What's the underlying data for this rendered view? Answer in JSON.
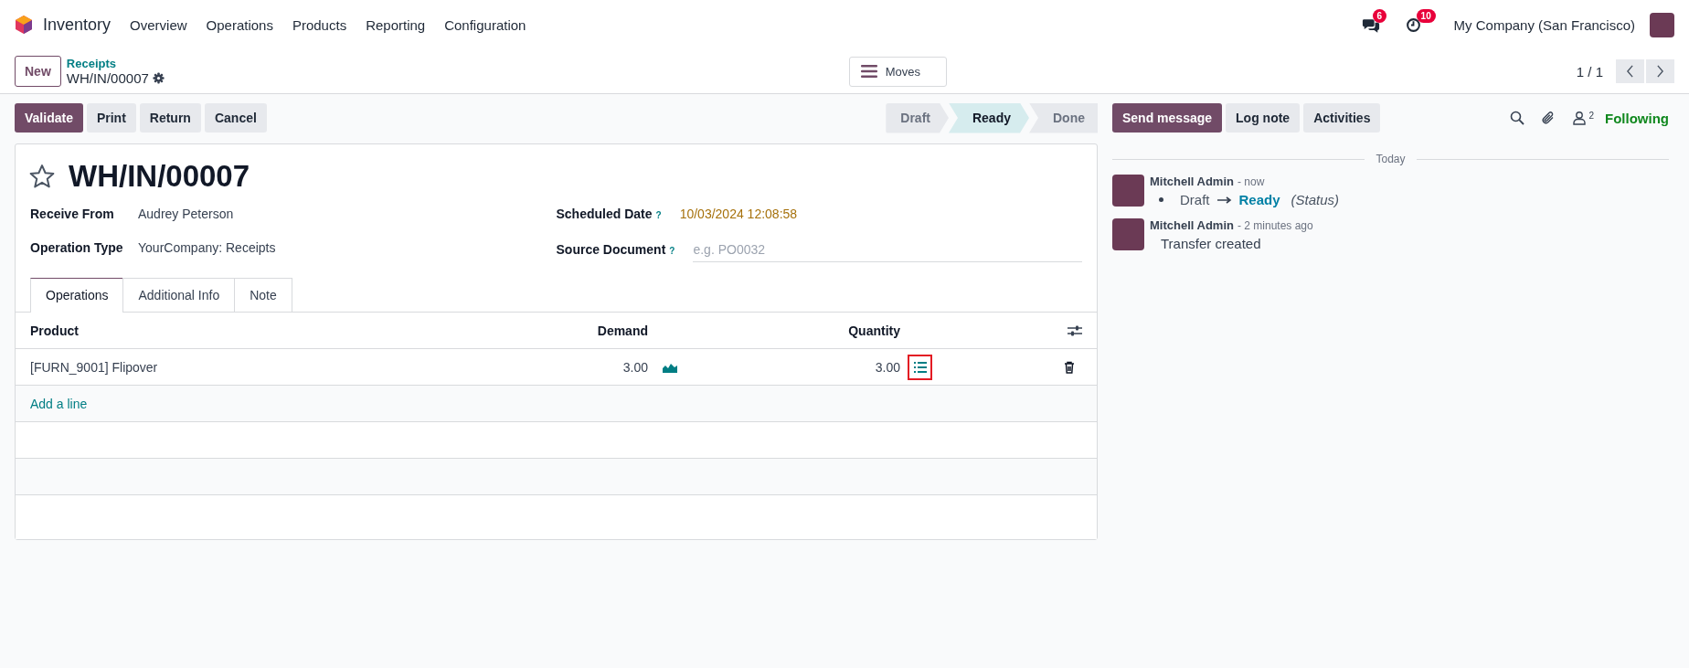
{
  "navbar": {
    "app": "Inventory",
    "menus": [
      "Overview",
      "Operations",
      "Products",
      "Reporting",
      "Configuration"
    ],
    "messages_badge": "6",
    "activities_badge": "10",
    "company": "My Company (San Francisco)"
  },
  "control_panel": {
    "new_button": "New",
    "breadcrumb": "Receipts",
    "record": "WH/IN/00007",
    "moves_button": "Moves",
    "pager": "1 / 1"
  },
  "actions": [
    {
      "label": "Validate",
      "kind": "primary"
    },
    {
      "label": "Print",
      "kind": "secondary"
    },
    {
      "label": "Return",
      "kind": "secondary"
    },
    {
      "label": "Cancel",
      "kind": "secondary"
    }
  ],
  "statusbar": [
    {
      "label": "Draft",
      "selected": false
    },
    {
      "label": "Ready",
      "selected": true
    },
    {
      "label": "Done",
      "selected": false
    }
  ],
  "form": {
    "title": "WH/IN/00007",
    "starred": false,
    "fields_left": [
      {
        "label": "Receive From",
        "value": "Audrey Peterson"
      },
      {
        "label": "Operation Type",
        "value": "YourCompany: Receipts"
      }
    ],
    "fields_right": [
      {
        "label": "Scheduled Date",
        "help": "?",
        "kind": "date",
        "value": "10/03/2024 12:08:58"
      },
      {
        "label": "Source Document",
        "help": "?",
        "kind": "input",
        "placeholder": "e.g. PO0032"
      }
    ],
    "tabs": [
      {
        "label": "Operations",
        "selected": true
      },
      {
        "label": "Additional Info",
        "selected": false
      },
      {
        "label": "Note",
        "selected": false
      }
    ],
    "table": {
      "columns": [
        "Product",
        "Demand",
        "Quantity"
      ],
      "rows": [
        {
          "product": "[FURN_9001] Flipover",
          "demand": "3.00",
          "quantity": "3.00",
          "highlighted": true
        }
      ],
      "add_line": "Add a line"
    }
  },
  "chatter": {
    "buttons": [
      {
        "label": "Send message",
        "kind": "primary"
      },
      {
        "label": "Log note",
        "kind": "secondary"
      },
      {
        "label": "Activities",
        "kind": "secondary"
      }
    ],
    "followers_count": "2",
    "following": "Following",
    "date_separator": "Today",
    "messages": [
      {
        "author": "Mitchell Admin",
        "time": "- now",
        "kind": "tracking",
        "old": "Draft",
        "new": "Ready",
        "field": "(Status)"
      },
      {
        "author": "Mitchell Admin",
        "time": "- 2 minutes ago",
        "kind": "text",
        "body": "Transfer created"
      }
    ]
  }
}
